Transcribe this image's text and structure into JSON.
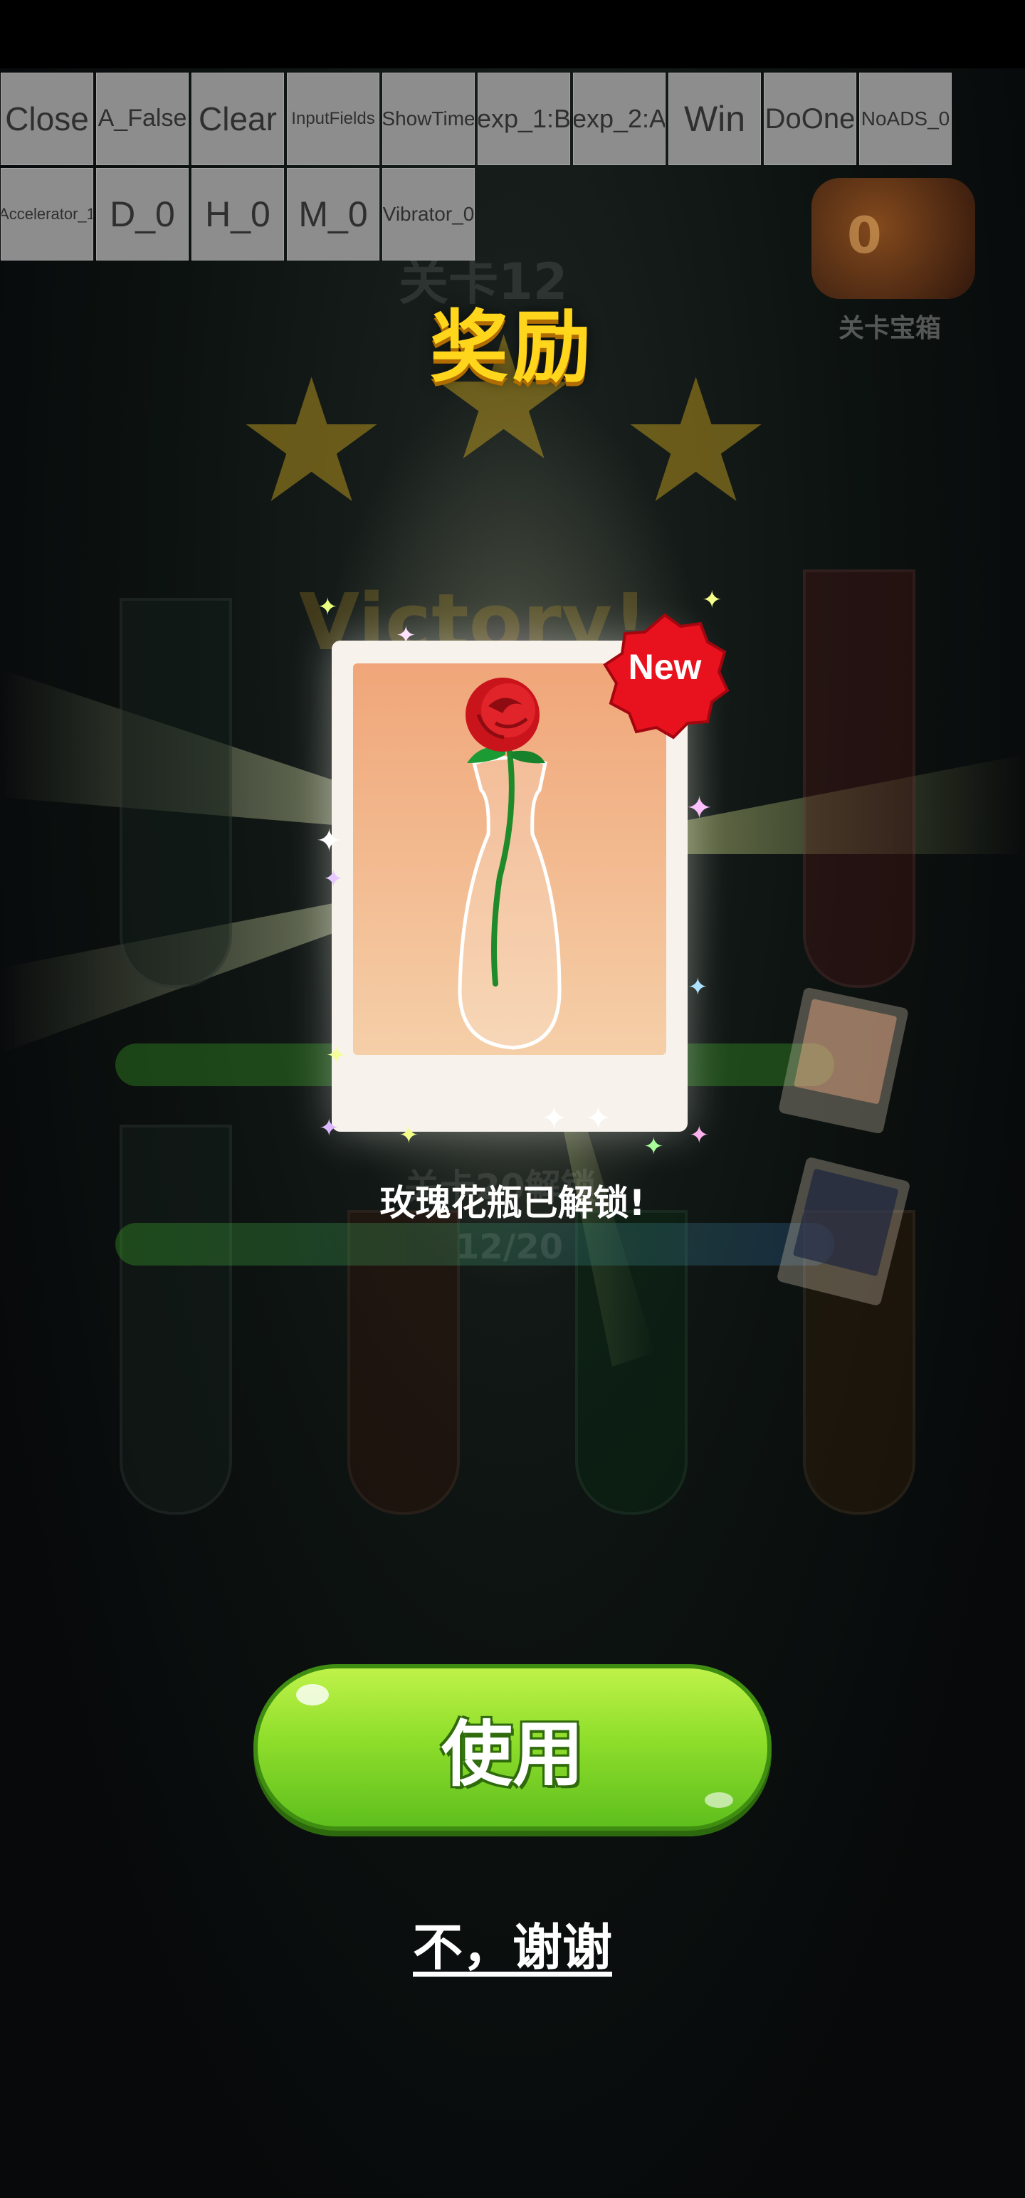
{
  "debug_buttons": [
    {
      "label": "Close"
    },
    {
      "label": "A_False"
    },
    {
      "label": "Clear"
    },
    {
      "label": "InputFields"
    },
    {
      "label": "ShowTime"
    },
    {
      "label": "exp_1:B"
    },
    {
      "label": "exp_2:A"
    },
    {
      "label": "Win"
    },
    {
      "label": "DoOne"
    },
    {
      "label": "NoADS_0"
    },
    {
      "label": "Accelerator_1"
    },
    {
      "label": "D_0"
    },
    {
      "label": "H_0"
    },
    {
      "label": "M_0"
    },
    {
      "label": "Vibrator_0"
    }
  ],
  "reward": {
    "title": "奖励",
    "badge": "New",
    "unlock_message": "玫瑰花瓶已解锁!",
    "use_button": "使用",
    "decline_button": "不，谢谢"
  },
  "background": {
    "level_title": "关卡12",
    "victory_text": "Victory!",
    "chest_label": "关卡宝箱",
    "chest_count": "0",
    "progress_label": "关卡20解锁",
    "progress_value": "12/20",
    "progress_fraction": 0.6
  },
  "colors": {
    "title": "#ffd61c",
    "badge": "#e8121e",
    "use_button": "#8fde2b"
  }
}
